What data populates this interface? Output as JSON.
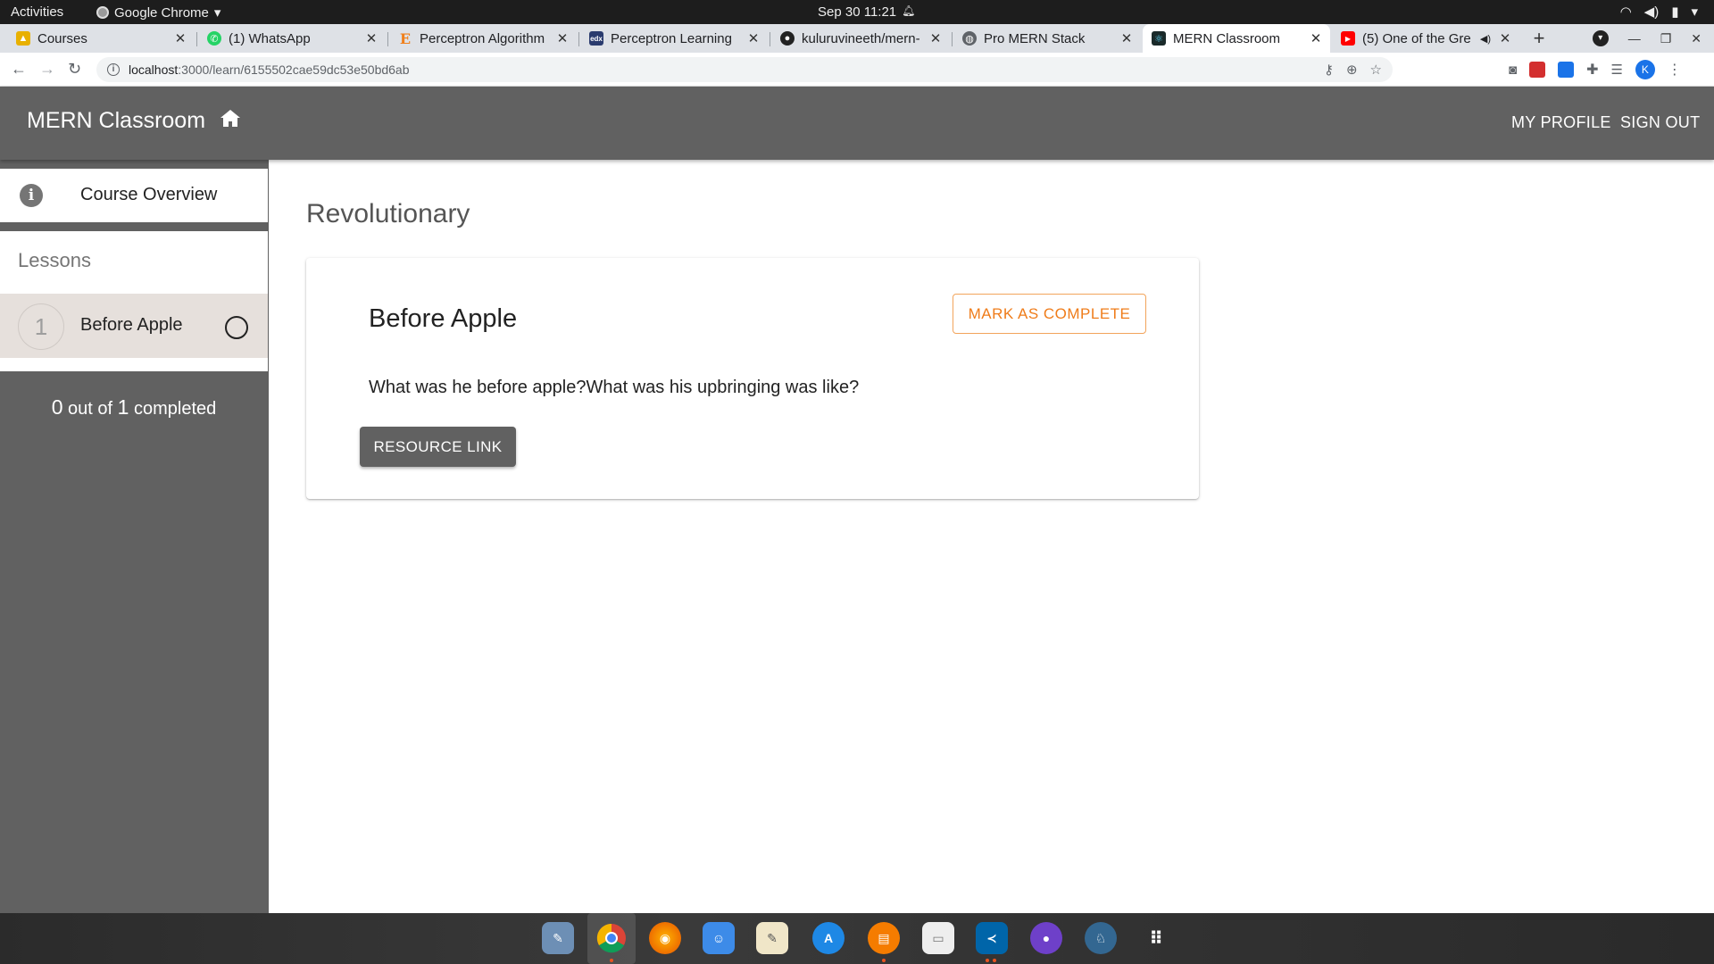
{
  "system": {
    "activities": "Activities",
    "app_name": "Google Chrome",
    "clock": "Sep 30  11:21"
  },
  "browser": {
    "tabs": [
      {
        "label": "Courses",
        "icon": "courses-favicon",
        "color": "#e8b000"
      },
      {
        "label": "(1) WhatsApp",
        "icon": "whatsapp-favicon",
        "color": "#25d366"
      },
      {
        "label": "Perceptron Algorithm",
        "icon": "edureka-favicon",
        "color": "#f07f1a"
      },
      {
        "label": "Perceptron Learning",
        "icon": "edx-favicon",
        "color": "#2a3b6e"
      },
      {
        "label": "kuluruvineeth/mern-",
        "icon": "github-favicon",
        "color": "#222222"
      },
      {
        "label": "Pro MERN Stack",
        "icon": "globe-favicon",
        "color": "#5f6368"
      },
      {
        "label": "MERN Classroom",
        "icon": "react-favicon",
        "color": "#1a2a2a"
      },
      {
        "label": "(5) One of the Gre",
        "icon": "youtube-favicon",
        "color": "#ff0000"
      }
    ],
    "active_tab": 6,
    "url_host": "localhost",
    "url_path": ":3000/learn/6155502cae59dc53e50bd6ab",
    "profile_initial": "K"
  },
  "app": {
    "brand": "MERN Classroom",
    "nav": {
      "my_profile": "MY PROFILE",
      "sign_out": "SIGN OUT"
    }
  },
  "sidebar": {
    "overview_label": "Course Overview",
    "lessons_header": "Lessons",
    "lessons": [
      {
        "number": "1",
        "title": "Before Apple",
        "completed": false
      }
    ],
    "progress": {
      "completed": "0",
      "out_of_text": "out of",
      "total": "1",
      "suffix": "completed"
    }
  },
  "main": {
    "course_title": "Revolutionary",
    "lesson": {
      "title": "Before Apple",
      "mark_complete_label": "MARK AS COMPLETE",
      "content": "What was he before apple?What was his upbringing was like?",
      "resource_label": "RESOURCE LINK"
    }
  },
  "colors": {
    "appbar": "#616161",
    "accent": "#ef7c1a",
    "lesson_bg": "#e6e0dc"
  },
  "dock": {
    "apps": [
      "screenshot-app-icon",
      "chrome-icon",
      "firefox-icon",
      "finder-icon",
      "notes-icon",
      "app-store-icon",
      "books-icon",
      "text-editor-icon",
      "vscode-icon",
      "github-desktop-icon",
      "postgres-icon",
      "app-grid-icon"
    ]
  }
}
